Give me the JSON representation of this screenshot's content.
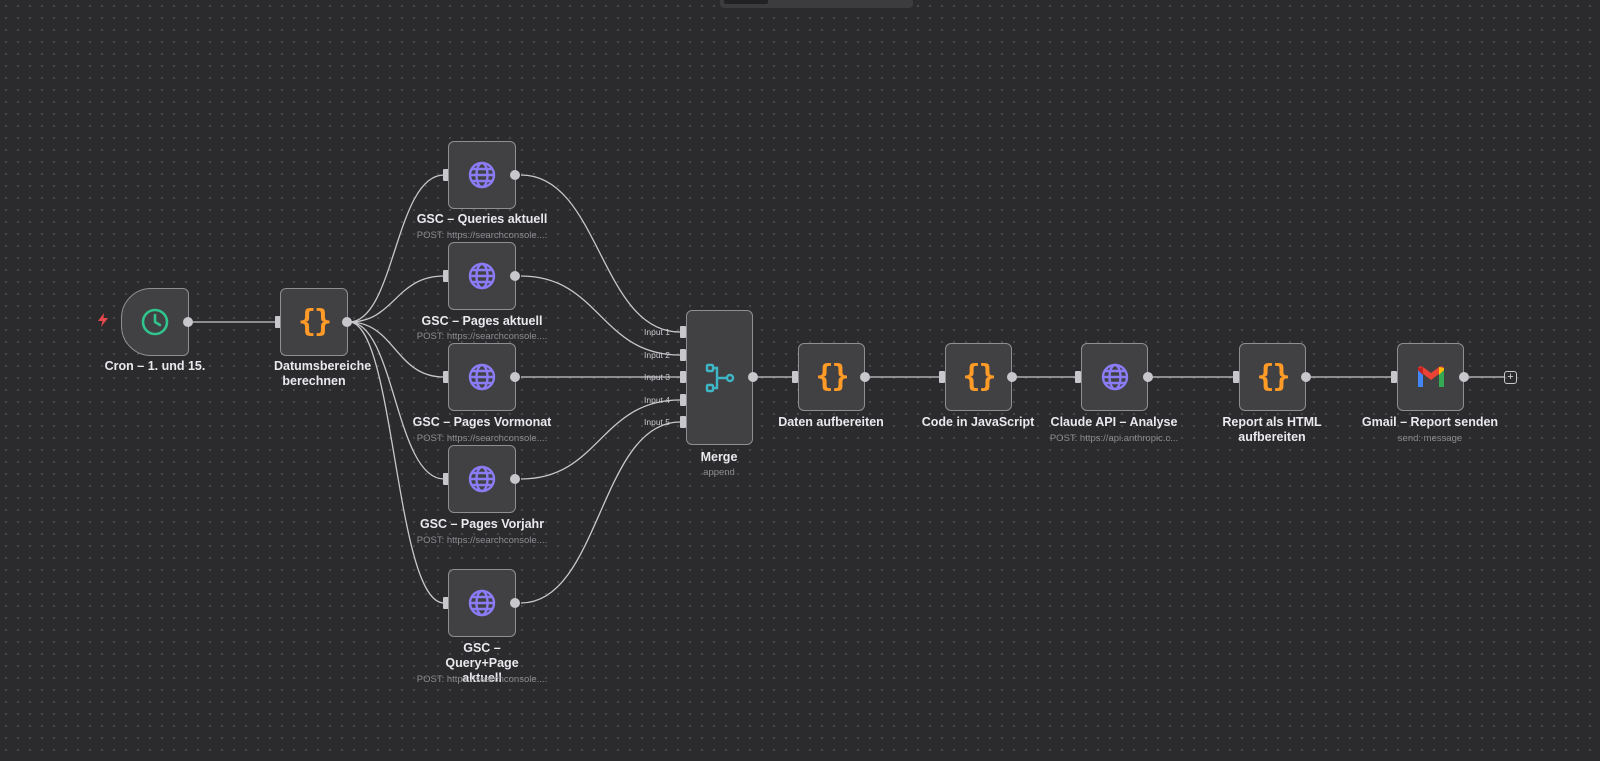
{
  "colors": {
    "background": "#2b2b2d",
    "node_fill": "#414144",
    "node_border": "#8e8e93",
    "edge": "#c8c8cc",
    "http_icon": "#8b7cf6",
    "code_icon": "#ff9b26",
    "schedule_icon": "#31c48d",
    "merge_icon": "#3fb6c6",
    "trigger_bolt": "#e5484d"
  },
  "nodes": {
    "cron": {
      "label": "Cron – 1. und 15.",
      "icon": "clock-icon"
    },
    "datum": {
      "label": "Datumsbereiche berechnen",
      "icon": "braces-icon",
      "braces": "{}"
    },
    "gsc_queries": {
      "label": "GSC – Queries aktuell",
      "sub": "POST: https://searchconsole....",
      "icon": "globe-icon"
    },
    "gsc_pages": {
      "label": "GSC – Pages aktuell",
      "sub": "POST: https://searchconsole....",
      "icon": "globe-icon"
    },
    "gsc_vormonat": {
      "label": "GSC – Pages Vormonat",
      "sub": "POST: https://searchconsole....",
      "icon": "globe-icon"
    },
    "gsc_vorjahr": {
      "label": "GSC – Pages Vorjahr",
      "sub": "POST: https://searchconsole....",
      "icon": "globe-icon"
    },
    "gsc_query_page": {
      "label": "GSC – Query+Page aktuell",
      "sub": "POST: https://searchconsole....",
      "icon": "globe-icon"
    },
    "merge": {
      "label": "Merge",
      "sub": "append",
      "icon": "merge-icon",
      "inputs": [
        "Input 1",
        "Input 2",
        "Input 3",
        "Input 4",
        "Input 5"
      ]
    },
    "daten": {
      "label": "Daten aufbereiten",
      "icon": "braces-icon",
      "braces": "{}"
    },
    "code_js": {
      "label": "Code in JavaScript",
      "icon": "braces-icon",
      "braces": "{}"
    },
    "claude": {
      "label": "Claude API – Analyse",
      "sub": "POST: https://api.anthropic.c...",
      "icon": "globe-icon"
    },
    "report": {
      "label": "Report als HTML aufbereiten",
      "icon": "braces-icon",
      "braces": "{}"
    },
    "gmail": {
      "label": "Gmail – Report senden",
      "sub": "send: message",
      "icon": "gmail-icon"
    }
  },
  "add_node_symbol": "+"
}
